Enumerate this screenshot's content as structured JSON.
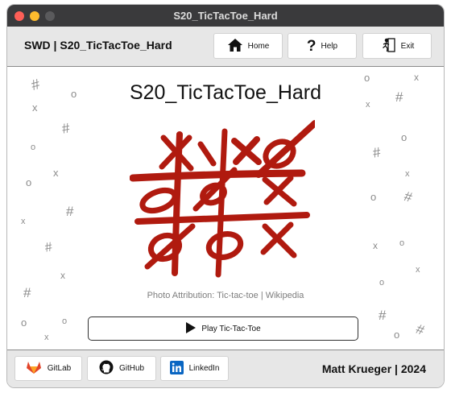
{
  "window": {
    "title": "S20_TicTacToe_Hard"
  },
  "header": {
    "app_name": "SWD | S20_TicTacToe_Hard",
    "home_label": "Home",
    "help_label": "Help",
    "exit_label": "Exit"
  },
  "main": {
    "title": "S20_TicTacToe_Hard",
    "attribution": "Photo Attribution: Tic-tac-toe | Wikipedia",
    "play_label": "Play Tic-Tac-Toe",
    "board_color": "#b01a0f"
  },
  "footer": {
    "gitlab_label": "GitLab",
    "github_label": "GitHub",
    "linkedin_label": "LinkedIn",
    "credit": "Matt Krueger | 2024"
  },
  "colors": {
    "gitlab": "#e24329",
    "linkedin": "#0a66c2",
    "titlebar": "#3a3a3c",
    "bar_background": "#e7e7e7"
  },
  "icons": [
    "home-icon",
    "help-icon",
    "exit-icon",
    "play-icon",
    "gitlab-icon",
    "github-icon",
    "linkedin-icon"
  ]
}
